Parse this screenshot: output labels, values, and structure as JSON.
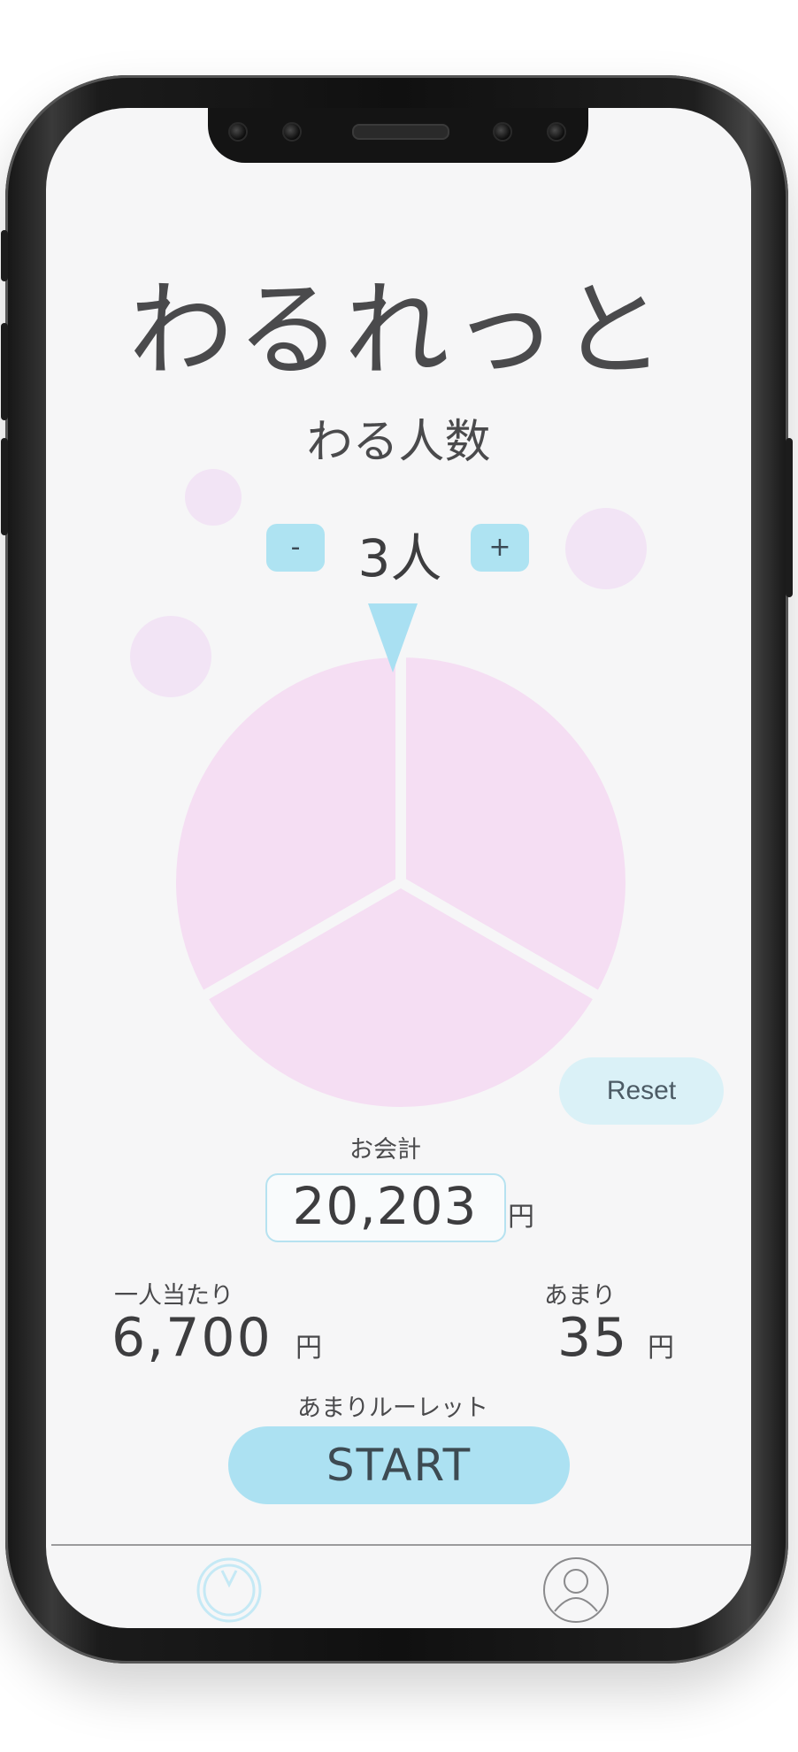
{
  "app": {
    "title": "わるれっと",
    "subtitle": "わる人数"
  },
  "people": {
    "minus_label": "-",
    "count_label": "3人",
    "plus_label": "+",
    "count": 3
  },
  "roulette": {
    "slices": 3,
    "slice_color": "#f5def3",
    "divider_color": "#f6f6f7",
    "pointer_color": "#a9e0f2"
  },
  "reset_label": "Reset",
  "bill": {
    "label": "お会計",
    "value": "20,203",
    "unit": "円"
  },
  "per_person": {
    "label": "一人当たり",
    "value": "6,700",
    "unit": "円"
  },
  "remainder": {
    "label": "あまり",
    "value": "35",
    "unit": "円"
  },
  "roulette_action": {
    "caption": "あまりルーレット",
    "start_label": "START"
  },
  "tabbar": {
    "items": [
      {
        "icon": "roulette-tab-icon",
        "active": true
      },
      {
        "icon": "profile-tab-icon",
        "active": false
      }
    ]
  },
  "colors": {
    "accent": "#ace1f2",
    "background": "#f6f6f7",
    "pink": "#f5def3",
    "text": "#3d3d3f"
  }
}
